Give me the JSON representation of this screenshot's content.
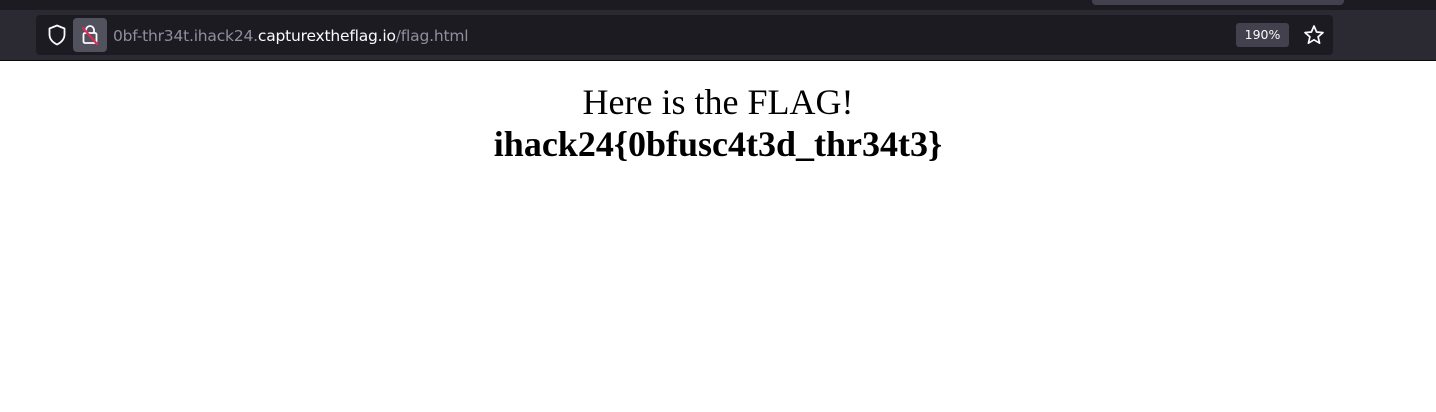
{
  "browser": {
    "url": {
      "subdomain": "0bf-thr34t.ihack24.",
      "domain": "capturextheflag.io",
      "path": "/flag.html"
    },
    "zoom": "190%",
    "icons": {
      "tracking": "shield-icon",
      "security": "insecure-lock-icon",
      "bookmark": "star-icon"
    },
    "colors": {
      "chrome_bg": "#2b2a33",
      "urlbar_bg": "#1c1b22",
      "insecure_slash": "#e22850"
    }
  },
  "page": {
    "headline": "Here is the FLAG!",
    "flag": "ihack24{0bfusc4t3d_thr34t3}"
  }
}
